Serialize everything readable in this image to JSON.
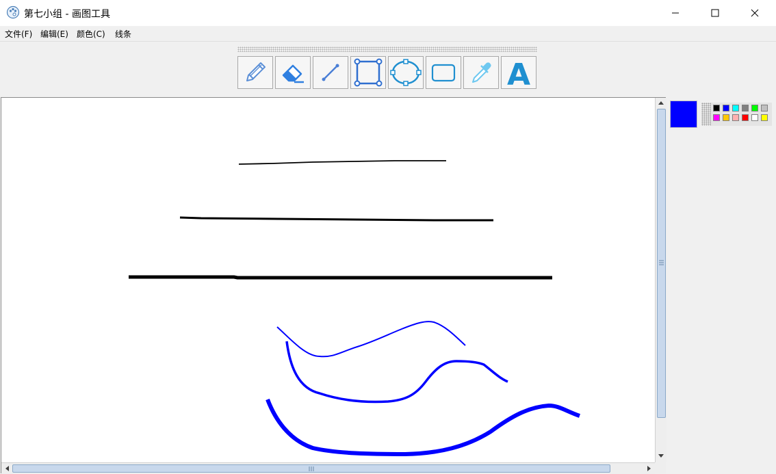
{
  "window": {
    "title": "第七小组 - 画图工具",
    "icon": "palette-icon",
    "controls": [
      "minimize-icon",
      "maximize-icon",
      "close-icon"
    ]
  },
  "menu": {
    "items": [
      {
        "label": "文件(F)"
      },
      {
        "label": "编辑(E)"
      },
      {
        "label": "颜色(C)"
      },
      {
        "label": "线条"
      }
    ]
  },
  "toolbar": {
    "tools": [
      {
        "name": "pencil-icon"
      },
      {
        "name": "eraser-icon"
      },
      {
        "name": "line-icon"
      },
      {
        "name": "rectangle-icon"
      },
      {
        "name": "ellipse-icon"
      },
      {
        "name": "rounded-rectangle-icon"
      },
      {
        "name": "eyedropper-icon"
      },
      {
        "name": "text-icon",
        "glyph": "A"
      }
    ]
  },
  "colors": {
    "current": "#0000ff",
    "palette": [
      "#000000",
      "#0000ff",
      "#00ffff",
      "#808080",
      "#00ff00",
      "#c0c0c0",
      "#ff00ff",
      "#ffc800",
      "#ffafaf",
      "#ff0000",
      "#ffffff",
      "#ffff00"
    ]
  }
}
